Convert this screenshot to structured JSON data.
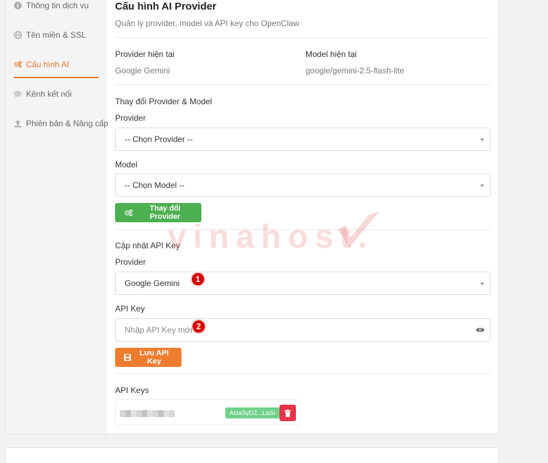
{
  "sidebar": {
    "items": [
      {
        "label": "Thông tin dịch vụ",
        "icon": "info-icon"
      },
      {
        "label": "Tên miền & SSL",
        "icon": "globe-icon"
      },
      {
        "label": "Cấu hình AI",
        "icon": "gears-icon",
        "active": true
      },
      {
        "label": "Kênh kết nối",
        "icon": "chat-icon"
      },
      {
        "label": "Phiên bản & Nâng cấp",
        "icon": "upload-icon"
      }
    ],
    "accent_color": "#e8772e"
  },
  "main": {
    "title": "Cấu hình AI Provider",
    "subtitle": "Quản lý provider, model và API key cho OpenClaw",
    "current": {
      "provider_label": "Provider hiện tại",
      "provider_value": "Google Gemini",
      "model_label": "Model hiện tại",
      "model_value": "google/gemini-2.5-flash-lite"
    },
    "change": {
      "heading": "Thay đổi Provider & Model",
      "provider_label": "Provider",
      "provider_select": "-- Chọn Provider --",
      "model_label": "Model",
      "model_select": "-- Chọn Model --",
      "button_label": "Thay đổi Provider",
      "button_color": "#4caf50"
    },
    "update_key": {
      "heading": "Cập nhật API Key",
      "provider_label": "Provider",
      "provider_select": "Google Gemini",
      "apikey_label": "API Key",
      "apikey_placeholder": "Nhập API Key mới",
      "button_label": "Lưu API Key",
      "button_color": "#ee7d30"
    },
    "api_keys": {
      "heading": "API Keys",
      "items": [
        {
          "masked_key": "AIzaSyDZ...LaSI"
        }
      ]
    }
  },
  "annotations": [
    "1",
    "2"
  ],
  "watermark": "vinahost."
}
